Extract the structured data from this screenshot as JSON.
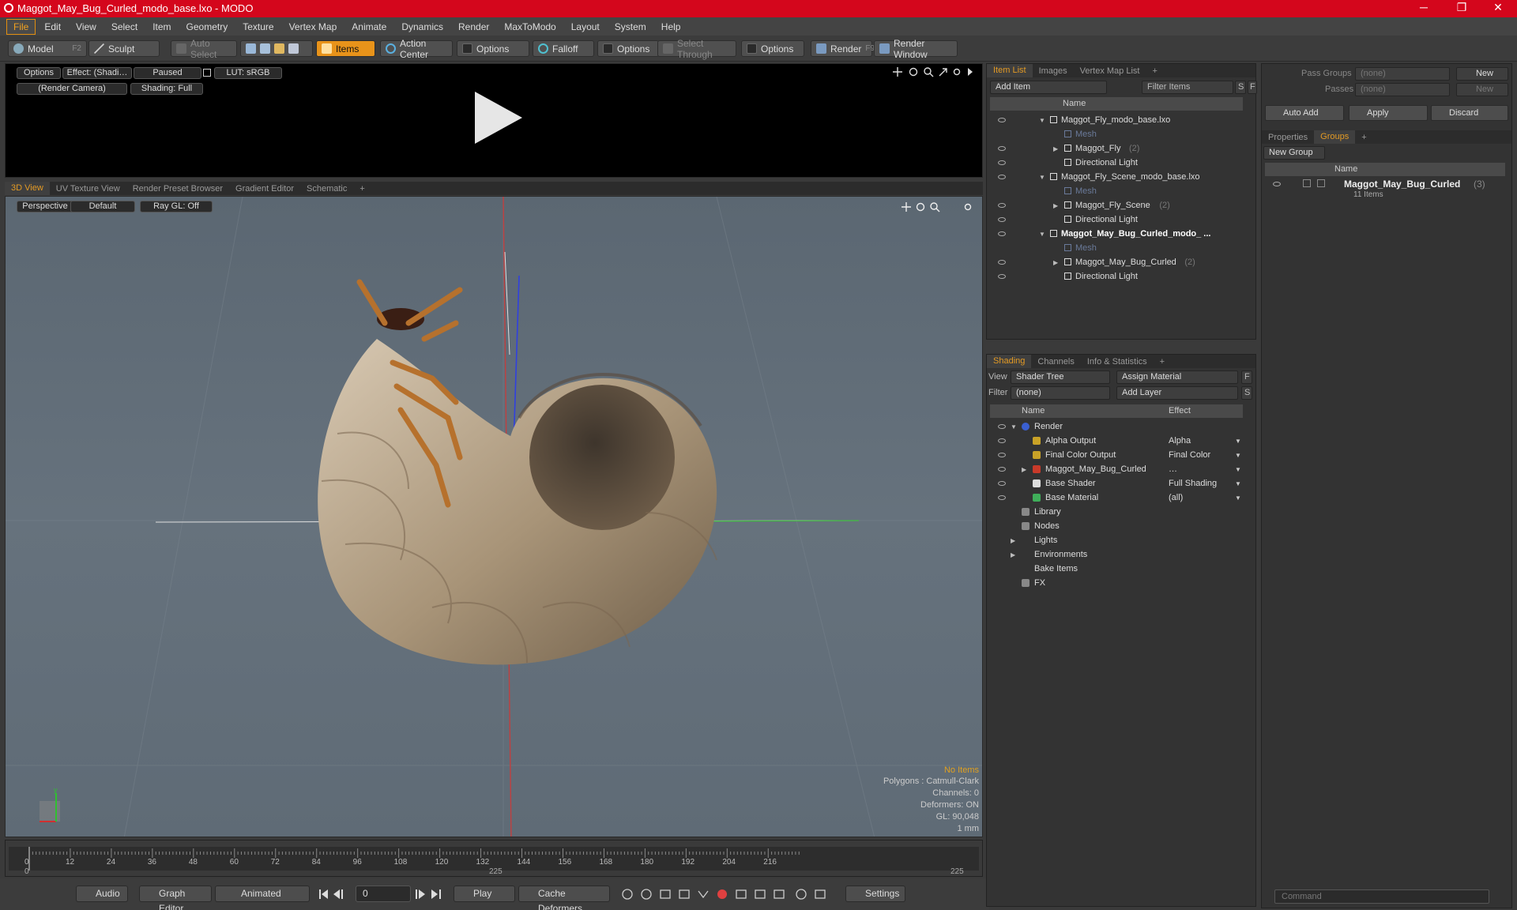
{
  "window": {
    "title": "Maggot_May_Bug_Curled_modo_base.lxo - MODO",
    "min": "─",
    "max": "❐",
    "close": "✕"
  },
  "menu": [
    "File",
    "Edit",
    "View",
    "Select",
    "Item",
    "Geometry",
    "Texture",
    "Vertex Map",
    "Animate",
    "Dynamics",
    "Render",
    "MaxToModo",
    "Layout",
    "System",
    "Help"
  ],
  "toolbar": {
    "model": "Model",
    "model_key": "F2",
    "sculpt": "Sculpt",
    "auto_select": "Auto Select",
    "items": "Items",
    "action_center": "Action Center",
    "options1": "Options",
    "falloff": "Falloff",
    "options2": "Options",
    "select_through": "Select Through",
    "options3": "Options",
    "render": "Render",
    "render_key": "F9",
    "render_window": "Render Window"
  },
  "preview": {
    "options": "Options",
    "effect": "Effect: (Shadi…",
    "paused": "Paused",
    "lut": "LUT: sRGB",
    "camera": "(Render Camera)",
    "shading": "Shading: Full"
  },
  "viewport_tabs": [
    "3D View",
    "UV Texture View",
    "Render Preset Browser",
    "Gradient Editor",
    "Schematic",
    "+"
  ],
  "viewport": {
    "perspective": "Perspective",
    "default": "Default",
    "raygl": "Ray GL: Off",
    "info": [
      "No Items",
      "Polygons : Catmull-Clark",
      "Channels: 0",
      "Deformers: ON",
      "GL: 90,048",
      "1 mm"
    ]
  },
  "timeline": {
    "ticks": [
      "0",
      "12",
      "24",
      "36",
      "48",
      "60",
      "72",
      "84",
      "96",
      "108",
      "120",
      "132",
      "144",
      "156",
      "168",
      "180",
      "192",
      "204",
      "216"
    ],
    "start": "0",
    "mid": "225",
    "end": "225"
  },
  "bottombar": {
    "audio": "Audio",
    "graph_editor": "Graph Editor",
    "animated": "Animated",
    "frame": "0",
    "play": "Play",
    "cache": "Cache Deformers",
    "settings": "Settings"
  },
  "itemlist": {
    "tabs": [
      "Item List",
      "Images",
      "Vertex Map List",
      "+"
    ],
    "add_item": "Add Item",
    "filter": "Filter Items",
    "s": "S",
    "f": "F",
    "name_col": "Name",
    "rows": [
      {
        "label": "Maggot_Fly_modo_base.lxo",
        "indent": 0,
        "arrow": "▼",
        "bold": false,
        "dim": false,
        "count": ""
      },
      {
        "label": "Mesh",
        "indent": 1,
        "arrow": "",
        "bold": false,
        "dim": true,
        "count": ""
      },
      {
        "label": "Maggot_Fly",
        "indent": 1,
        "arrow": "▶",
        "bold": false,
        "dim": false,
        "count": "(2)"
      },
      {
        "label": "Directional Light",
        "indent": 1,
        "arrow": "",
        "bold": false,
        "dim": false,
        "count": ""
      },
      {
        "label": "Maggot_Fly_Scene_modo_base.lxo",
        "indent": 0,
        "arrow": "▼",
        "bold": false,
        "dim": false,
        "count": ""
      },
      {
        "label": "Mesh",
        "indent": 1,
        "arrow": "",
        "bold": false,
        "dim": true,
        "count": ""
      },
      {
        "label": "Maggot_Fly_Scene",
        "indent": 1,
        "arrow": "▶",
        "bold": false,
        "dim": false,
        "count": "(2)"
      },
      {
        "label": "Directional Light",
        "indent": 1,
        "arrow": "",
        "bold": false,
        "dim": false,
        "count": ""
      },
      {
        "label": "Maggot_May_Bug_Curled_modo_ ...",
        "indent": 0,
        "arrow": "▼",
        "bold": true,
        "dim": false,
        "count": ""
      },
      {
        "label": "Mesh",
        "indent": 1,
        "arrow": "",
        "bold": false,
        "dim": true,
        "count": ""
      },
      {
        "label": "Maggot_May_Bug_Curled",
        "indent": 1,
        "arrow": "▶",
        "bold": false,
        "dim": false,
        "count": "(2)"
      },
      {
        "label": "Directional Light",
        "indent": 1,
        "arrow": "",
        "bold": false,
        "dim": false,
        "count": ""
      }
    ]
  },
  "shading": {
    "tabs": [
      "Shading",
      "Channels",
      "Info & Statistics",
      "+"
    ],
    "view_label": "View",
    "view_value": "Shader Tree",
    "assign": "Assign Material",
    "f": "F",
    "filter_label": "Filter",
    "filter_value": "(none)",
    "add_layer": "Add Layer",
    "s": "S",
    "name_col": "Name",
    "effect_col": "Effect",
    "rows": [
      {
        "label": "Render",
        "effect": "",
        "indent": 0,
        "arrow": "▼",
        "icon": "#3a5fd0"
      },
      {
        "label": "Alpha Output",
        "effect": "Alpha",
        "indent": 1,
        "arrow": "",
        "icon": "#c9a227"
      },
      {
        "label": "Final Color Output",
        "effect": "Final Color",
        "indent": 1,
        "arrow": "",
        "icon": "#c9a227"
      },
      {
        "label": "Maggot_May_Bug_Curled",
        "effect": "…",
        "indent": 1,
        "arrow": "▶",
        "icon": "#c83a2a"
      },
      {
        "label": "Base Shader",
        "effect": "Full Shading",
        "indent": 1,
        "arrow": "",
        "icon": "#dddddd"
      },
      {
        "label": "Base Material",
        "effect": "(all)",
        "indent": 1,
        "arrow": "",
        "icon": "#3fae5a"
      },
      {
        "label": "Library",
        "effect": "",
        "indent": 0,
        "arrow": "",
        "icon": "#888888"
      },
      {
        "label": "Nodes",
        "effect": "",
        "indent": 0,
        "arrow": "",
        "icon": "#888888"
      },
      {
        "label": "Lights",
        "effect": "",
        "indent": 0,
        "arrow": "▶",
        "icon": ""
      },
      {
        "label": "Environments",
        "effect": "",
        "indent": 0,
        "arrow": "▶",
        "icon": ""
      },
      {
        "label": "Bake Items",
        "effect": "",
        "indent": 0,
        "arrow": "",
        "icon": ""
      },
      {
        "label": "FX",
        "effect": "",
        "indent": 0,
        "arrow": "",
        "icon": "#888888"
      }
    ]
  },
  "right": {
    "pass_groups": "Pass Groups",
    "pass_groups_value": "(none)",
    "new": "New",
    "passes": "Passes",
    "passes_value": "(none)",
    "new2": "New",
    "auto_add": "Auto Add",
    "apply": "Apply",
    "discard": "Discard",
    "tabs": [
      "Properties",
      "Groups",
      "+"
    ],
    "new_group": "New Group",
    "name_col": "Name",
    "group_name": "Maggot_May_Bug_Curled",
    "group_count": "(3)",
    "group_items": "11 Items"
  },
  "command": {
    "placeholder": "Command"
  }
}
